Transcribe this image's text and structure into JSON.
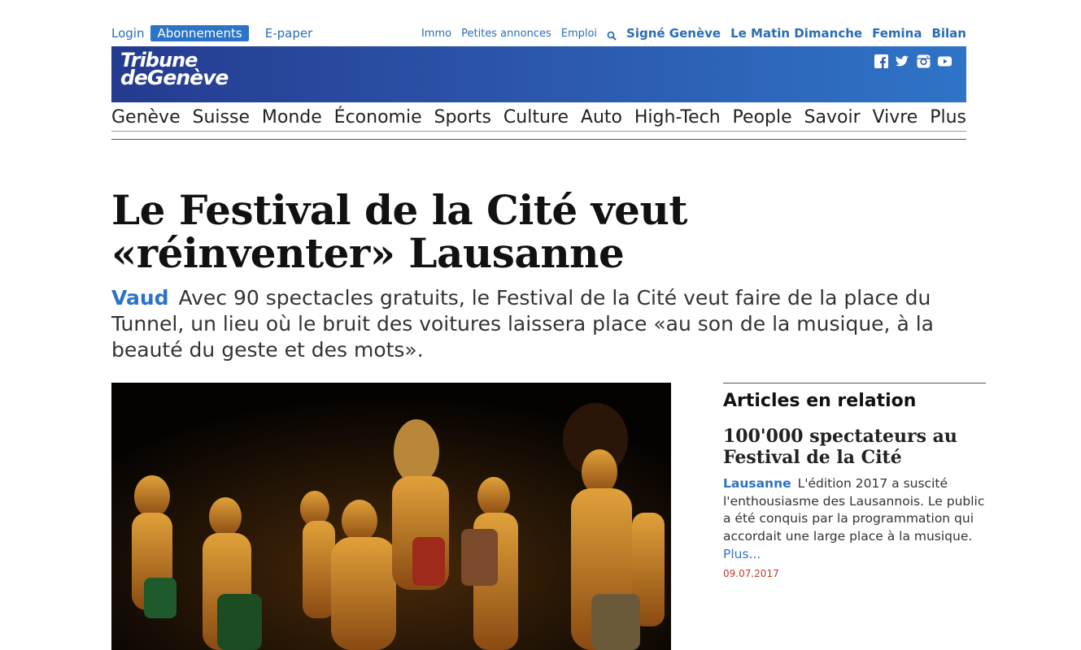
{
  "utility": {
    "login": "Login",
    "subscriptions": "Abonnements",
    "epaper": "E-paper",
    "right_small": [
      "Immo",
      "Petites annonces",
      "Emploi"
    ],
    "right_bold": [
      "Signé Genève",
      "Le Matin Dimanche",
      "Femina",
      "Bilan"
    ]
  },
  "masthead": {
    "logo_line1": "Tribune",
    "logo_line2": "deGenève",
    "socials": [
      "facebook-icon",
      "twitter-icon",
      "instagram-icon",
      "youtube-icon"
    ]
  },
  "nav": [
    "Genève",
    "Suisse",
    "Monde",
    "Économie",
    "Sports",
    "Culture",
    "Auto",
    "High-Tech",
    "People",
    "Savoir",
    "Vivre",
    "Plus"
  ],
  "article": {
    "headline": "Le Festival de la Cité veut «réinventer» Lausanne",
    "kicker": "Vaud",
    "lead": "Avec 90 spectacles gratuits, le Festival de la Cité veut faire de la place du Tunnel, un lieu où le bruit des voitures laissera place «au son de la musique, à la beauté du geste et des mots»."
  },
  "related": {
    "section_title": "Articles en relation",
    "items": [
      {
        "title": "100'000 spectateurs au Festival de la Cité",
        "kicker": "Lausanne",
        "text": "L'édition 2017 a suscité l'enthousiasme des Lausannois. Le public a été conquis par la programmation qui accordait une large place à la musique.",
        "more": "Plus...",
        "date": "09.07.2017"
      }
    ]
  },
  "colors": {
    "accent": "#2b74c6",
    "masthead_from": "#243b8f",
    "masthead_to": "#2e74c7",
    "date": "#c0392b"
  }
}
